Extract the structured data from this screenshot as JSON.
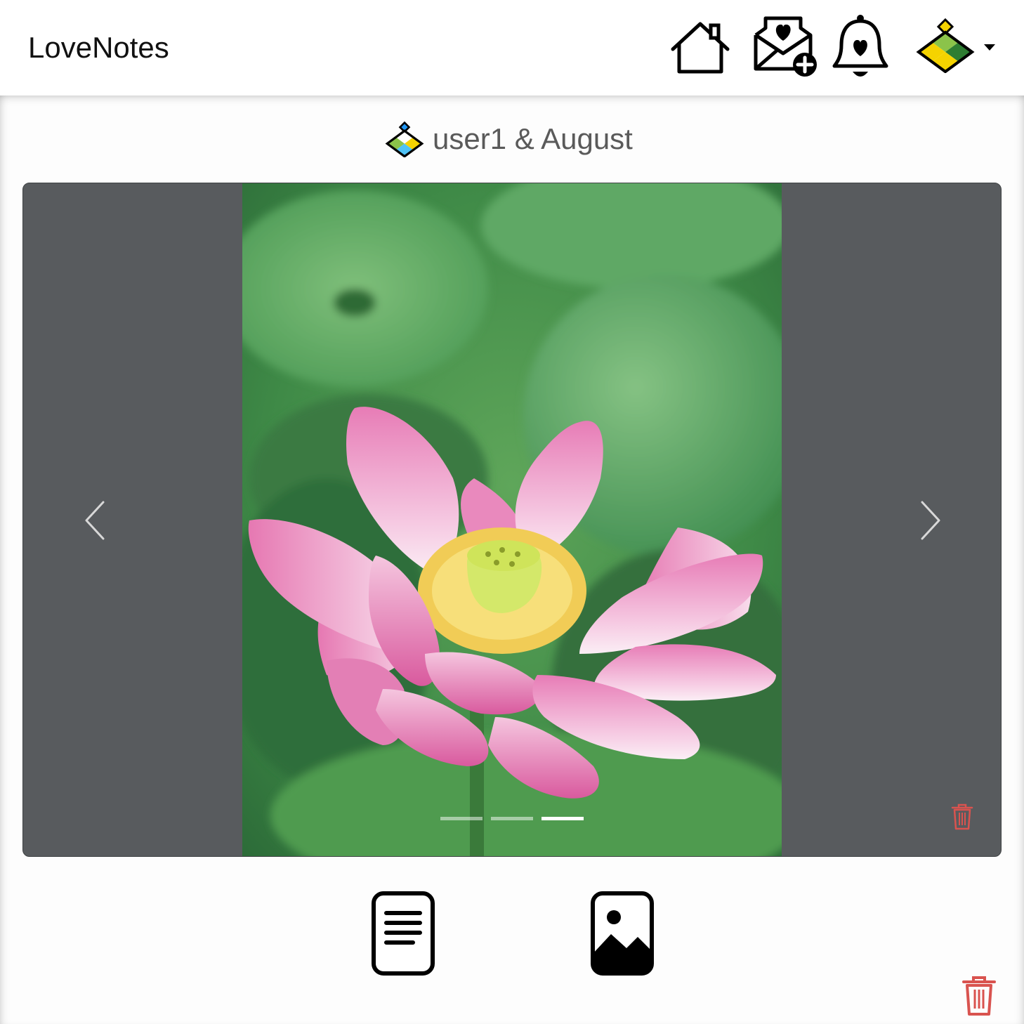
{
  "navbar": {
    "brand": "LoveNotes",
    "icons": [
      "home-icon",
      "new-note-icon",
      "notifications-icon",
      "user-avatar-icon",
      "caret-down-icon"
    ]
  },
  "couple": {
    "title": "user1 & August"
  },
  "carousel": {
    "slide_count": 3,
    "active_index": 2,
    "photo_subject": "pink lotus flower"
  },
  "actions": {
    "icons": [
      "text-note-icon",
      "image-note-icon",
      "delete-icon"
    ]
  },
  "colors": {
    "carousel_bg": "#585b5e",
    "delete_red": "#d9534f",
    "title_gray": "#5a5a5a"
  }
}
